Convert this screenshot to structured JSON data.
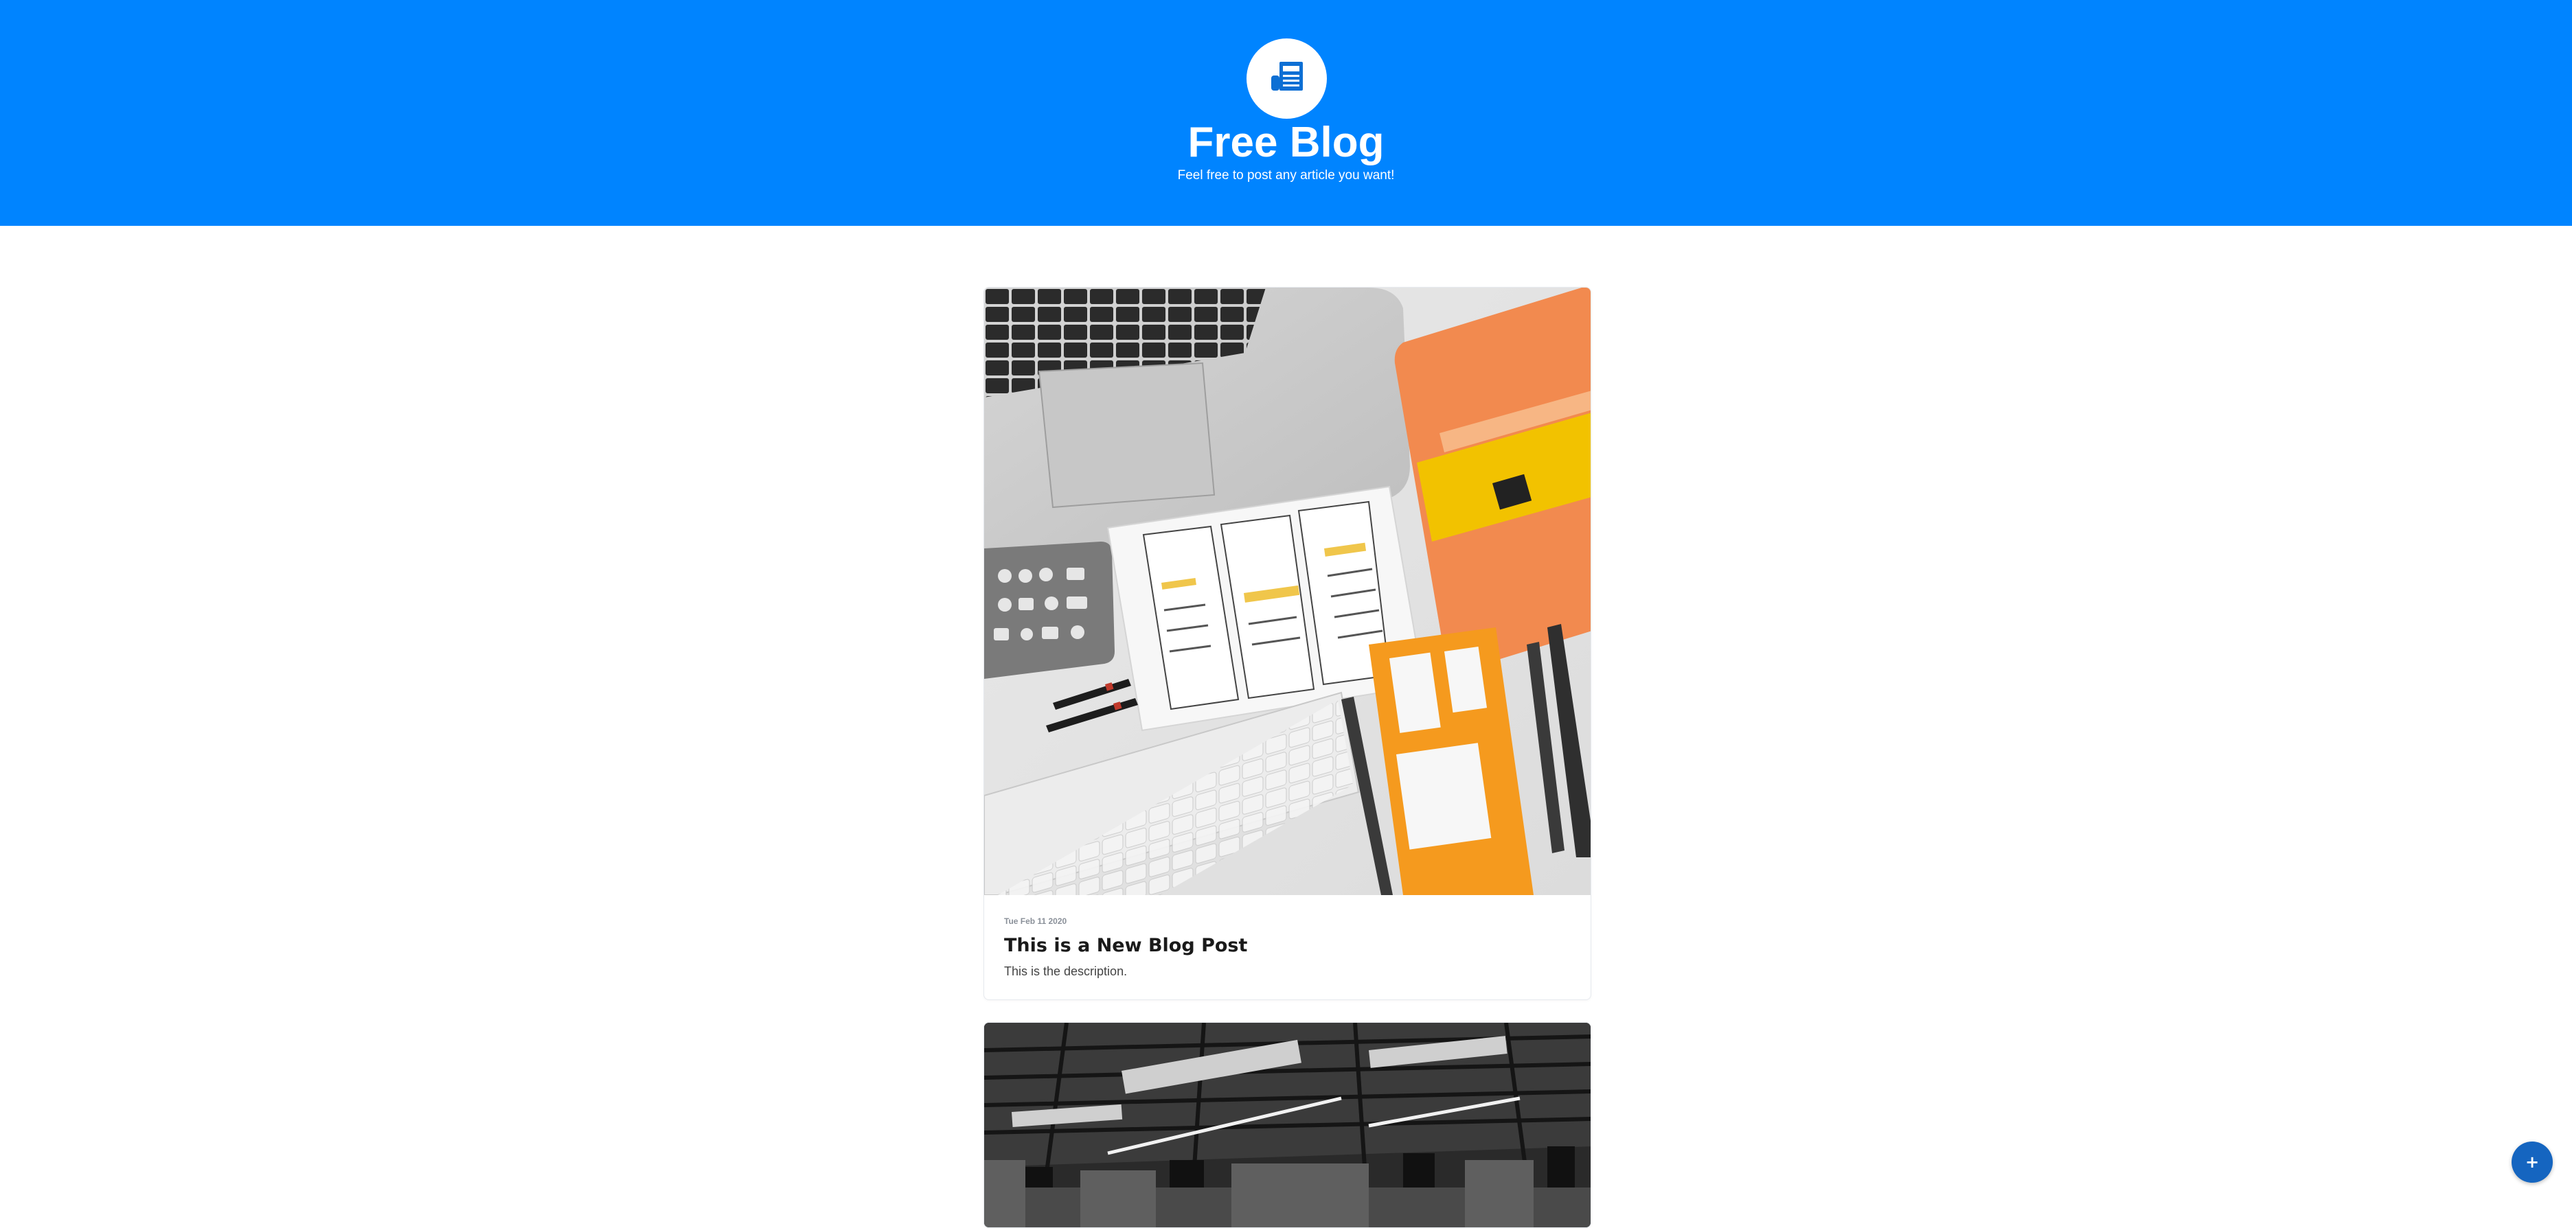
{
  "header": {
    "logo_icon": "newspaper-icon",
    "title": "Free Blog",
    "tagline": "Feel free to post any article you want!"
  },
  "posts": [
    {
      "date": "Tue Feb 11 2020",
      "title": "This is a New Blog Post",
      "description": "This is the description.",
      "image": "laptop-ux-sketchbook-flatlay"
    },
    {
      "image": "office-ceiling-interior"
    }
  ],
  "fab": {
    "label": "+",
    "icon": "plus-icon"
  },
  "colors": {
    "brand": "#0084ff",
    "fab": "#1565c0"
  }
}
